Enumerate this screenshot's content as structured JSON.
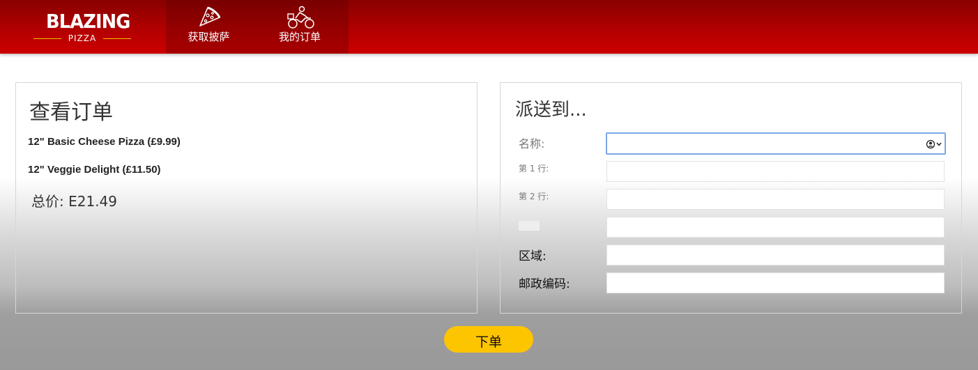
{
  "header": {
    "logo": {
      "top": "BLAZING",
      "bottom": "PIZZA"
    },
    "nav": [
      {
        "label": "获取披萨",
        "icon": "pizza-slice-icon"
      },
      {
        "label": "我的订单",
        "icon": "delivery-motorbike-icon"
      }
    ]
  },
  "order": {
    "title": "查看订单",
    "items": [
      "12\" Basic Cheese Pizza (£9.99)",
      "12\" Veggie Delight (£11.50)"
    ],
    "total_label": "总价:",
    "total_value": "E21.49"
  },
  "delivery": {
    "title": "派送到...",
    "labels": {
      "name": "名称:",
      "line1": "第 1 行:",
      "line2": "第 2 行:",
      "region": "区域:",
      "postal": "邮政编码:"
    },
    "values": {
      "name": "",
      "line1": "",
      "line2": "",
      "city": "",
      "region": "",
      "postal": ""
    },
    "autofill_icon": "contact-autofill-icon"
  },
  "actions": {
    "place_order": "下单"
  },
  "colors": {
    "header_red": "#cc0000",
    "button_yellow": "#fdc500",
    "focus_blue": "#7aa7e6"
  }
}
